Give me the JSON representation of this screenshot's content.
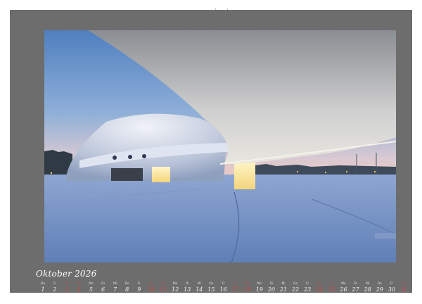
{
  "calendar": {
    "month_title": "Oktober 2026",
    "days": [
      {
        "weekday": "Do",
        "num": "1",
        "weekend": false
      },
      {
        "weekday": "Fr",
        "num": "2",
        "weekend": false
      },
      {
        "weekday": "Sa",
        "num": "3",
        "weekend": true
      },
      {
        "weekday": "So",
        "num": "4",
        "weekend": true
      },
      {
        "weekday": "Mo",
        "num": "5",
        "weekend": false
      },
      {
        "weekday": "Di",
        "num": "6",
        "weekend": false
      },
      {
        "weekday": "Mi",
        "num": "7",
        "weekend": false
      },
      {
        "weekday": "Do",
        "num": "8",
        "weekend": false
      },
      {
        "weekday": "Fr",
        "num": "9",
        "weekend": false
      },
      {
        "weekday": "Sa",
        "num": "10",
        "weekend": true
      },
      {
        "weekday": "So",
        "num": "11",
        "weekend": true
      },
      {
        "weekday": "Mo",
        "num": "12",
        "weekend": false
      },
      {
        "weekday": "Di",
        "num": "13",
        "weekend": false
      },
      {
        "weekday": "Mi",
        "num": "14",
        "weekend": false
      },
      {
        "weekday": "Do",
        "num": "15",
        "weekend": false
      },
      {
        "weekday": "Fr",
        "num": "16",
        "weekend": false
      },
      {
        "weekday": "Sa",
        "num": "17",
        "weekend": true
      },
      {
        "weekday": "So",
        "num": "18",
        "weekend": true
      },
      {
        "weekday": "Mo",
        "num": "19",
        "weekend": false
      },
      {
        "weekday": "Di",
        "num": "20",
        "weekend": false
      },
      {
        "weekday": "Mi",
        "num": "21",
        "weekend": false
      },
      {
        "weekday": "Do",
        "num": "22",
        "weekend": false
      },
      {
        "weekday": "Fr",
        "num": "23",
        "weekend": false
      },
      {
        "weekday": "Sa",
        "num": "24",
        "weekend": true
      },
      {
        "weekday": "So",
        "num": "25",
        "weekend": true
      },
      {
        "weekday": "Mo",
        "num": "26",
        "weekend": false
      },
      {
        "weekday": "Di",
        "num": "27",
        "weekend": false
      },
      {
        "weekday": "Mi",
        "num": "28",
        "weekend": false
      },
      {
        "weekday": "Do",
        "num": "29",
        "weekend": false
      },
      {
        "weekday": "Fr",
        "num": "30",
        "weekend": false
      },
      {
        "weekday": "Sa",
        "num": "31",
        "weekend": true
      }
    ]
  },
  "colors": {
    "page_background": "#6d6d6d",
    "weekend_text": "#cc4a4a",
    "weekday_text": "#f2f2f2"
  },
  "photo": {
    "subject": "architecture-photo"
  }
}
